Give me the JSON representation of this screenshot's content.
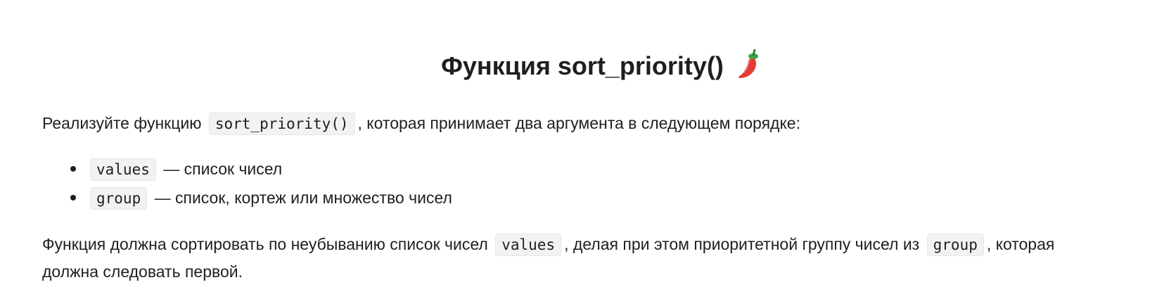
{
  "heading": {
    "title": "Функция sort_priority()",
    "icon": "chili-pepper-icon"
  },
  "intro": {
    "before": "Реализуйте функцию",
    "code": "sort_priority()",
    "after": ", которая принимает два аргумента в следующем порядке:"
  },
  "args": [
    {
      "code": "values",
      "text": "— список чисел"
    },
    {
      "code": "group",
      "text": "— список, кортеж или множество чисел"
    }
  ],
  "description": {
    "part1": "Функция должна сортировать по неубыванию список чисел",
    "code1": "values",
    "part2": ", делая при этом приоритетной группу чисел из",
    "code2": "group",
    "part3": ", которая",
    "line2": "должна следовать первой."
  }
}
